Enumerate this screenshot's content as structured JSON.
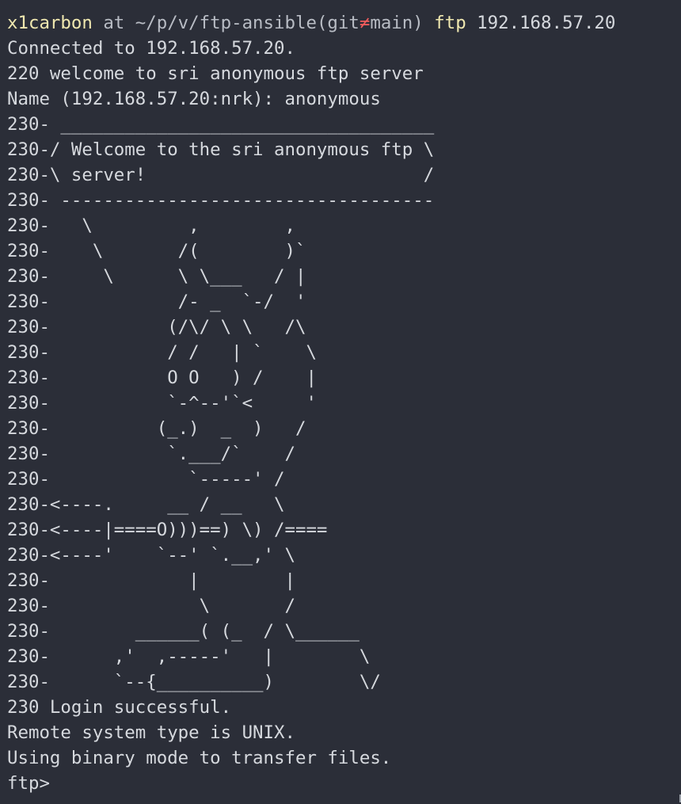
{
  "prompt": {
    "host": "x1carbon",
    "at": " at ",
    "path": "~/p/v/ftp-ansible",
    "git_open": "(git",
    "git_symbol": "≠",
    "git_branch": "main)",
    "command": " ftp",
    "argument": " 192.168.57.20"
  },
  "lines": [
    "Connected to 192.168.57.20.",
    "220 welcome to sri anonymous ftp server",
    "Name (192.168.57.20:nrk): anonymous",
    "230- ___________________________________",
    "230-/ Welcome to the sri anonymous ftp \\",
    "230-\\ server!                          /",
    "230- -----------------------------------",
    "230-   \\         ,        ,",
    "230-    \\       /(        )`",
    "230-     \\      \\ \\___   / |",
    "230-            /- _  `-/  '",
    "230-           (/\\/ \\ \\   /\\",
    "230-           / /   | `    \\",
    "230-           O O   ) /    |",
    "230-           `-^--'`<     '",
    "230-          (_.)  _  )   /",
    "230-           `.___/`    /",
    "230-             `-----' /",
    "230-<----.     __ / __   \\",
    "230-<----|====O)))==) \\) /====",
    "230-<----'    `--' `.__,' \\",
    "230-             |        |",
    "230-              \\       /",
    "230-        ______( (_  / \\______",
    "230-      ,'  ,-----'   |        \\",
    "230-      `--{__________)        \\/",
    "230 Login successful.",
    "Remote system type is UNIX.",
    "Using binary mode to transfer files.",
    "ftp>"
  ],
  "colors": {
    "background": "#2b2e38",
    "text": "#d6d9de",
    "host": "#f0e8b0",
    "git_symbol": "#f25c5c"
  }
}
